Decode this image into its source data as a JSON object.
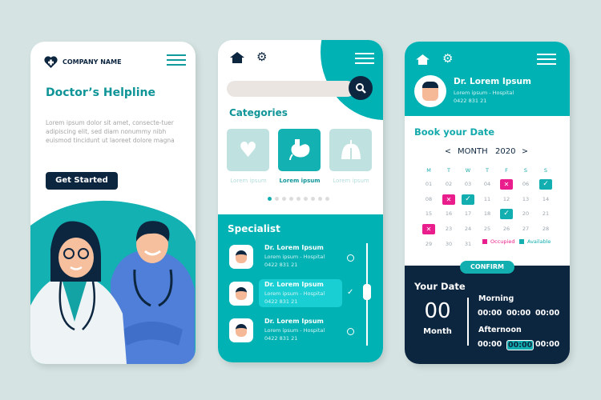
{
  "colors": {
    "teal": "#00b2b4",
    "navy": "#0d2640",
    "occupied": "#e91e8c",
    "background": "#d5e4e3"
  },
  "screen1": {
    "logo_icon": "heart-plus-icon",
    "company": "COMPANY NAME",
    "title": "Doctor’s Helpline",
    "body": "Lorem ipsum dolor sit amet, consecte-tuer adipiscing elit, sed diam nonummy nibh euismod tincidunt ut laoreet dolore magna",
    "cta": "Get Started"
  },
  "screen2": {
    "search_placeholder": "",
    "categories_title": "Categories",
    "categories": [
      {
        "label": "Lorem ipsum",
        "icon": "heart-icon",
        "active": false
      },
      {
        "label": "Lorem ipsum",
        "icon": "stomach-icon",
        "active": true
      },
      {
        "label": "Lorem ipsum",
        "icon": "lungs-icon",
        "active": false
      }
    ],
    "pager": {
      "pages": 9,
      "current": 1
    },
    "specialist_title": "Specialist",
    "specialists": [
      {
        "name": "Dr. Lorem Ipsum",
        "hospital": "Lorem ipsum - Hospital",
        "phone": "0422 831 21",
        "selected": false
      },
      {
        "name": "Dr. Lorem Ipsum",
        "hospital": "Lorem ipsum - Hospital",
        "phone": "0422 831 21",
        "selected": true
      },
      {
        "name": "Dr. Lorem Ipsum",
        "hospital": "Lorem ipsum - Hospital",
        "phone": "0422 831 21",
        "selected": false
      }
    ]
  },
  "screen3": {
    "doctor": {
      "name": "Dr. Lorem Ipsum",
      "hospital": "Lorem ipsum - Hospital",
      "phone": "0422 831 21"
    },
    "book_title": "Book your Date",
    "prev": "<",
    "month": "MONTH",
    "year": "2020",
    "next": ">",
    "weekdays": [
      "M",
      "T",
      "W",
      "T",
      "F",
      "S",
      "S"
    ],
    "days": [
      "01",
      "02",
      "03",
      "04",
      "05",
      "06",
      "07",
      "08",
      "09",
      "10",
      "11",
      "12",
      "13",
      "14",
      "15",
      "16",
      "17",
      "18",
      "19",
      "20",
      "21",
      "22",
      "23",
      "24",
      "25",
      "26",
      "27",
      "28",
      "29",
      "30",
      "31"
    ],
    "occupied": [
      "05",
      "09",
      "22"
    ],
    "available": [
      "07",
      "10",
      "19"
    ],
    "legend_occupied": "Occupied",
    "legend_available": "Available",
    "confirm": "CONFIRM",
    "your_date_title": "Your Date",
    "date_value": "00",
    "date_unit": "Month",
    "morning_label": "Morning",
    "morning_times": [
      "00:00",
      "00:00",
      "00:00"
    ],
    "afternoon_label": "Afternoon",
    "afternoon_times": [
      "00:00",
      "00:00",
      "00:00"
    ],
    "afternoon_selected": 1
  }
}
